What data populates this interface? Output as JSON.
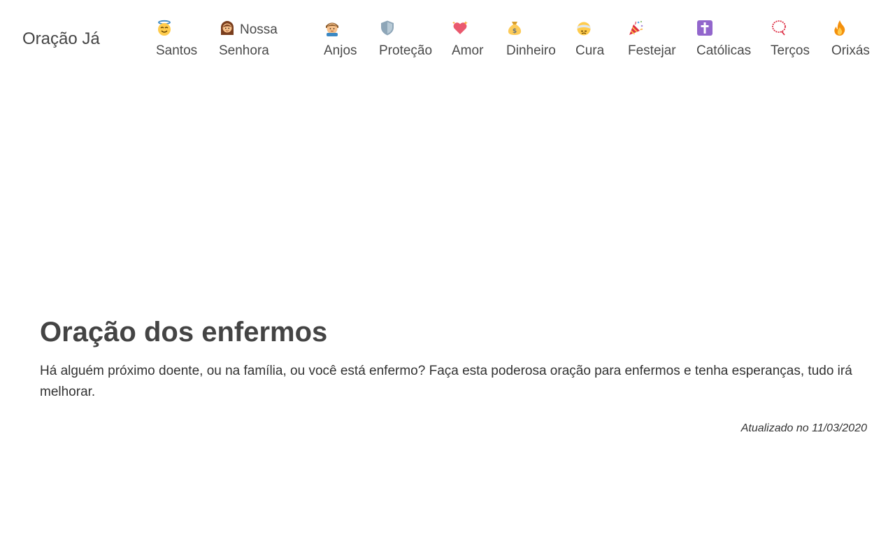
{
  "header": {
    "brand": "Oração Já",
    "nav": [
      {
        "label": "Santos",
        "icon": "angel-halo-icon"
      },
      {
        "label_1": "Nossa",
        "label_2": "Senhora",
        "icon": "woman-icon"
      },
      {
        "label": "Anjos",
        "icon": "baby-angel-icon"
      },
      {
        "label": "Proteção",
        "icon": "shield-icon"
      },
      {
        "label": "Amor",
        "icon": "sparkling-heart-icon"
      },
      {
        "label": "Dinheiro",
        "icon": "money-bag-icon"
      },
      {
        "label": "Cura",
        "icon": "head-bandage-icon"
      },
      {
        "label": "Festejar",
        "icon": "party-popper-icon"
      },
      {
        "label": "Católicas",
        "icon": "latin-cross-icon"
      },
      {
        "label": "Terços",
        "icon": "rosary-icon"
      },
      {
        "label": "Orixás",
        "icon": "fire-icon"
      }
    ]
  },
  "main": {
    "title": "Oração dos enfermos",
    "description": "Há alguém próximo doente, ou na família, ou você está enfermo? Faça esta poderosa oração para enfermos e tenha esperanças, tudo irá melhorar.",
    "updated": "Atualizado no 11/03/2020"
  },
  "colors": {
    "text": "#444444",
    "background": "#ffffff"
  }
}
